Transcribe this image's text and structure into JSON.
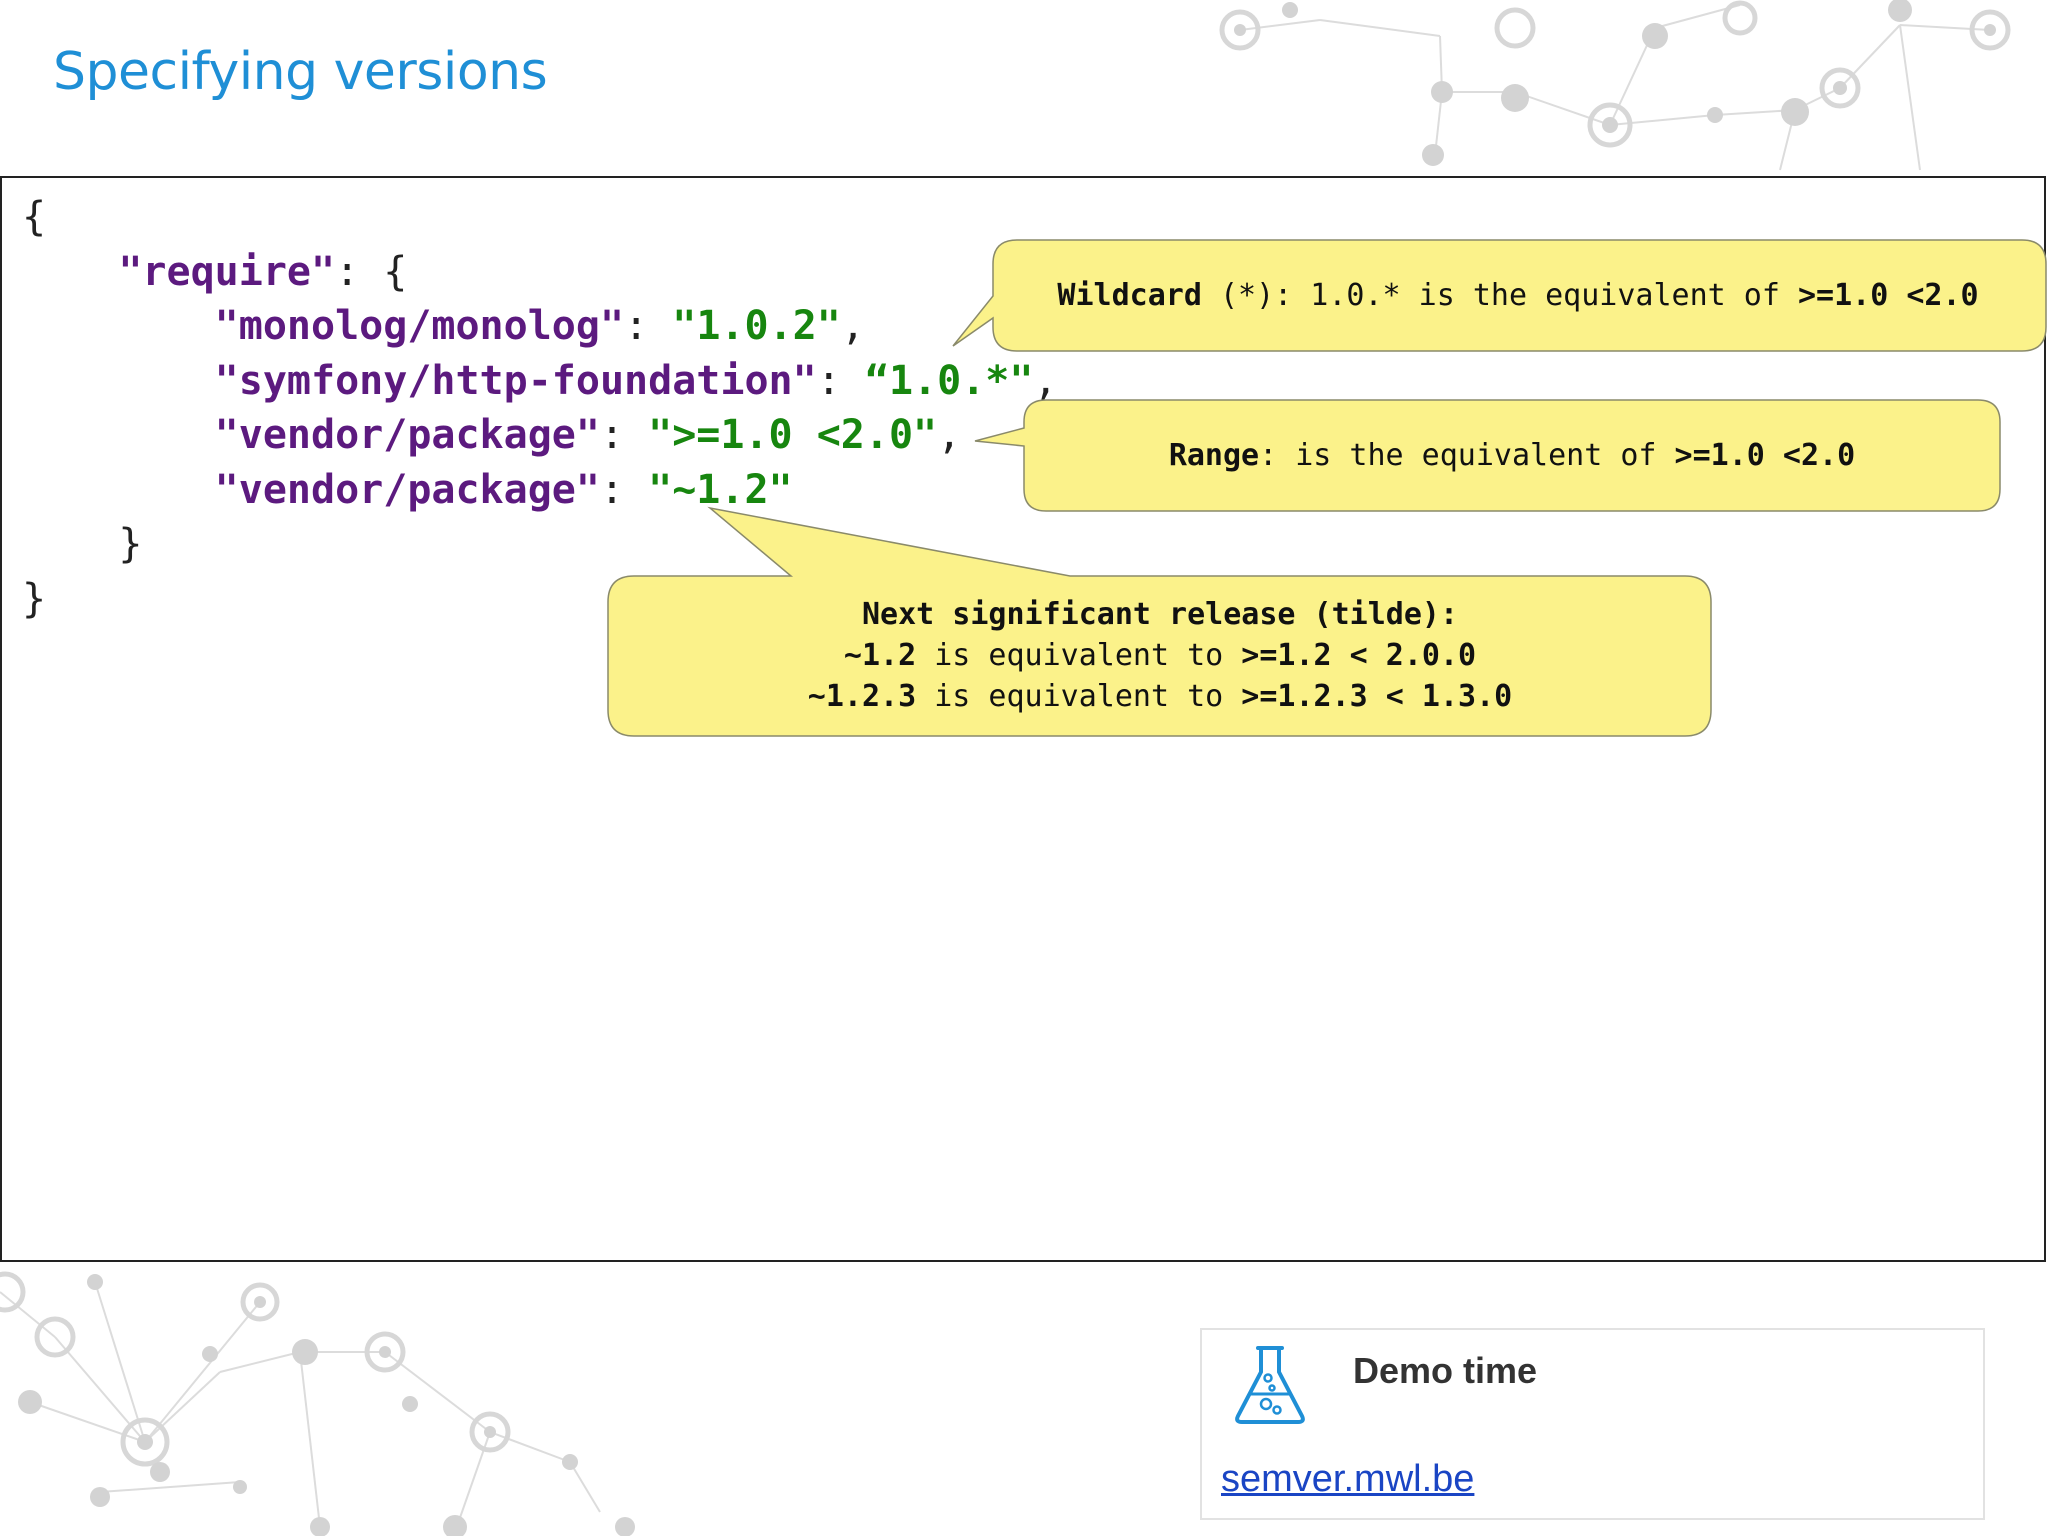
{
  "slide": {
    "title": "Specifying versions"
  },
  "code": {
    "lines": [
      {
        "indent": "",
        "key": "",
        "sep": "",
        "value": "",
        "trail": "{"
      },
      {
        "indent": "    ",
        "key": "\"require\"",
        "sep": ": {",
        "value": "",
        "trail": ""
      },
      {
        "indent": "        ",
        "key": "\"monolog/monolog\"",
        "sep": ": ",
        "value": "\"1.0.2\"",
        "trail": ","
      },
      {
        "indent": "        ",
        "key": "\"symfony/http-foundation\"",
        "sep": ": ",
        "value": "“1.0.*\"",
        "trail": ","
      },
      {
        "indent": "        ",
        "key": "\"vendor/package\"",
        "sep": ": ",
        "value": "\">=1.0 <2.0\"",
        "trail": ","
      },
      {
        "indent": "        ",
        "key": "\"vendor/package\"",
        "sep": ": ",
        "value": "\"~1.2\"",
        "trail": ""
      },
      {
        "indent": "    ",
        "key": "",
        "sep": "",
        "value": "",
        "trail": "}"
      },
      {
        "indent": "",
        "key": "",
        "sep": "",
        "value": "",
        "trail": "}"
      }
    ]
  },
  "callouts": {
    "wildcard": {
      "label": "Wildcard",
      "middle": " (*): 1.0.* is the equivalent of ",
      "range": ">=1.0 <2.0"
    },
    "range": {
      "label": "Range",
      "middle": ": is the equivalent of ",
      "range": ">=1.0 <2.0"
    },
    "tilde": {
      "heading": "Next significant release (tilde):",
      "line1_version": "~1.2",
      "line1_middle": " is equivalent to ",
      "line1_range": ">=1.2 < 2.0.0",
      "line2_version": "~1.2.3",
      "line2_middle": " is equivalent to ",
      "line2_range": ">=1.2.3 < 1.3.0"
    }
  },
  "demo": {
    "title": "Demo time",
    "link": "semver.mwl.be",
    "icon": "flask-icon"
  },
  "colors": {
    "title": "#1f8fd6",
    "key": "#5c1a7f",
    "string": "#17860f",
    "callout_fill": "#fbf28a",
    "link": "#1a45c4"
  }
}
